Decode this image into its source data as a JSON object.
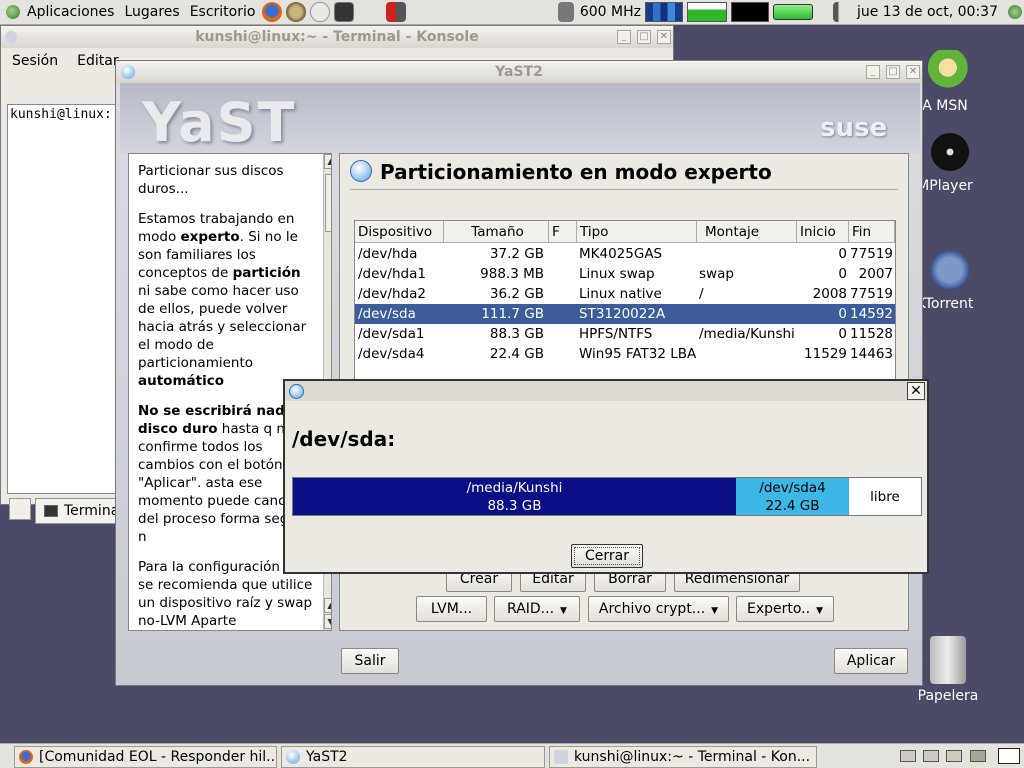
{
  "top_panel": {
    "menu": [
      "Aplicaciones",
      "Lugares",
      "Escritorio"
    ],
    "cpu_freq": "600 MHz",
    "clock": "jue 13 de oct, 00:37"
  },
  "konsole": {
    "title": "kunshi@linux:~ - Terminal - Konsole",
    "menu": [
      "Sesión",
      "Editar"
    ],
    "prompt": "kunshi@linux:",
    "tab_label": "Termina"
  },
  "yast": {
    "title": "YaST2",
    "logo": "YaST",
    "brand": "suse",
    "page_title": "Particionamiento en modo experto",
    "help": {
      "p1": "Particionar sus discos duros...",
      "p2_a": "Estamos trabajando en modo ",
      "p2_b": "experto",
      "p2_c": ". Si no le son familiares los conceptos de ",
      "p2_d": "partición",
      "p2_e": " ni sabe como hacer uso de ellos, puede volver hacia atrás y seleccionar el modo de particionamiento ",
      "p2_f": "automático",
      "p3_a": "No se escribirá nad al disco duro",
      "p3_b": " hasta q no confirme todos los cambios con el botón \"Aplicar\". asta ese momento puede cancelar del proceso forma segura n",
      "p4": "Para la configuración LVM se recomienda que utilice un dispositivo raíz y swap no-LVM Aparte"
    },
    "table": {
      "headers": [
        "Dispositivo",
        "Tamaño",
        "F",
        "Tipo",
        "Montaje",
        "Inicio",
        "Fin"
      ],
      "rows": [
        {
          "dev": "/dev/hda",
          "size": "37.2 GB",
          "f": "",
          "type": "MK4025GAS",
          "mount": "",
          "start": "0",
          "end": "77519"
        },
        {
          "dev": "/dev/hda1",
          "size": "988.3 MB",
          "f": "",
          "type": "Linux swap",
          "mount": "swap",
          "start": "0",
          "end": "2007"
        },
        {
          "dev": "/dev/hda2",
          "size": "36.2 GB",
          "f": "",
          "type": "Linux native",
          "mount": "/",
          "start": "2008",
          "end": "77519"
        },
        {
          "dev": "/dev/sda",
          "size": "111.7 GB",
          "f": "",
          "type": "ST3120022A",
          "mount": "",
          "start": "0",
          "end": "14592"
        },
        {
          "dev": "/dev/sda1",
          "size": "88.3 GB",
          "f": "",
          "type": "HPFS/NTFS",
          "mount": "/media/Kunshi",
          "start": "0",
          "end": "11528"
        },
        {
          "dev": "/dev/sda4",
          "size": "22.4 GB",
          "f": "",
          "type": "Win95 FAT32 LBA",
          "mount": "",
          "start": "11529",
          "end": "14463"
        }
      ],
      "selected_index": 3
    },
    "buttons_row1": [
      "Crear",
      "Editar",
      "Borrar",
      "Redimensionar"
    ],
    "buttons_row2": [
      "LVM...",
      "RAID...",
      "Archivo crypt...",
      "Experto.."
    ],
    "salir": "Salir",
    "aplicar": "Aplicar"
  },
  "dialog": {
    "device": "/dev/sda:",
    "segments": [
      {
        "mount": "/media/Kunshi",
        "size": "88.3 GB",
        "color": "#0b0f86"
      },
      {
        "mount": "/dev/sda4",
        "size": "22.4 GB",
        "color": "#3db8e6"
      },
      {
        "mount": "libre",
        "size": ""
      }
    ],
    "close_button": "Cerrar"
  },
  "desktop_icons": [
    "A MSN",
    "MPlayer",
    "KTorrent",
    "Papelera"
  ],
  "taskbar": [
    "[Comunidad EOL - Responder hil...",
    "YaST2",
    "kunshi@linux:~ - Terminal - Kon..."
  ]
}
